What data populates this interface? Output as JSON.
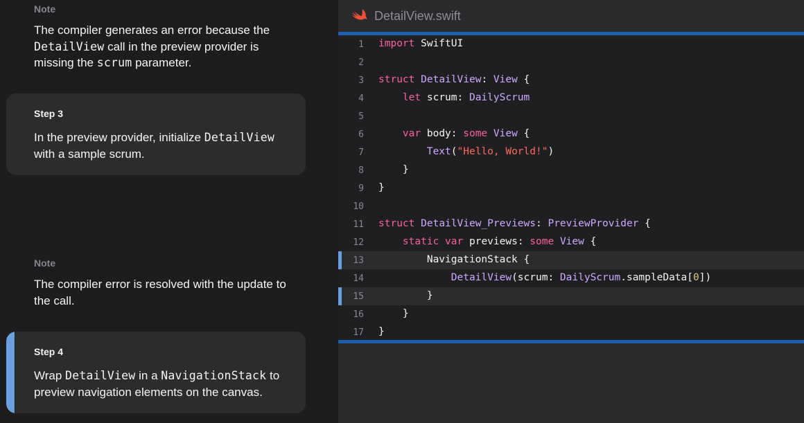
{
  "left": {
    "note1": {
      "label": "Note",
      "text_1": "The compiler generates an error because the ",
      "code_1": "DetailView",
      "text_2": " call in the preview provider is missing the ",
      "code_2": "scrum",
      "text_3": " parameter."
    },
    "step3": {
      "label": "Step 3",
      "text_1": "In the preview provider, initialize ",
      "code_1": "DetailView",
      "text_2": " with a sample scrum."
    },
    "note2": {
      "label": "Note",
      "text": "The compiler error is resolved with the update to the call."
    },
    "step4": {
      "label": "Step 4",
      "text_1": "Wrap ",
      "code_1": "DetailView",
      "text_2": " in a ",
      "code_2": "NavigationStack",
      "text_3": " to preview navigation elements on the canvas."
    }
  },
  "editor": {
    "file_name": "DetailView.swift",
    "icon": "swift-icon",
    "highlighted_lines": [
      13,
      15
    ],
    "lines": [
      {
        "n": "1",
        "tokens": [
          [
            "kw",
            "import"
          ],
          [
            "pl",
            " SwiftUI"
          ]
        ]
      },
      {
        "n": "2",
        "tokens": []
      },
      {
        "n": "3",
        "tokens": [
          [
            "kw",
            "struct"
          ],
          [
            "pl",
            " "
          ],
          [
            "ty",
            "DetailView"
          ],
          [
            "pl",
            ": "
          ],
          [
            "ty",
            "View"
          ],
          [
            "pl",
            " {"
          ]
        ]
      },
      {
        "n": "4",
        "tokens": [
          [
            "pl",
            "    "
          ],
          [
            "kw",
            "let"
          ],
          [
            "pl",
            " scrum: "
          ],
          [
            "ty",
            "DailyScrum"
          ]
        ]
      },
      {
        "n": "5",
        "tokens": []
      },
      {
        "n": "6",
        "tokens": [
          [
            "pl",
            "    "
          ],
          [
            "kw",
            "var"
          ],
          [
            "pl",
            " body: "
          ],
          [
            "kw",
            "some"
          ],
          [
            "pl",
            " "
          ],
          [
            "ty",
            "View"
          ],
          [
            "pl",
            " {"
          ]
        ]
      },
      {
        "n": "7",
        "tokens": [
          [
            "pl",
            "        "
          ],
          [
            "ty",
            "Text"
          ],
          [
            "pl",
            "("
          ],
          [
            "str",
            "\"Hello, World!\""
          ],
          [
            "pl",
            ")"
          ]
        ]
      },
      {
        "n": "8",
        "tokens": [
          [
            "pl",
            "    }"
          ]
        ]
      },
      {
        "n": "9",
        "tokens": [
          [
            "pl",
            "}"
          ]
        ]
      },
      {
        "n": "10",
        "tokens": []
      },
      {
        "n": "11",
        "tokens": [
          [
            "kw",
            "struct"
          ],
          [
            "pl",
            " "
          ],
          [
            "ty",
            "DetailView_Previews"
          ],
          [
            "pl",
            ": "
          ],
          [
            "ty",
            "PreviewProvider"
          ],
          [
            "pl",
            " {"
          ]
        ]
      },
      {
        "n": "12",
        "tokens": [
          [
            "pl",
            "    "
          ],
          [
            "kw",
            "static"
          ],
          [
            "pl",
            " "
          ],
          [
            "kw",
            "var"
          ],
          [
            "pl",
            " previews: "
          ],
          [
            "kw",
            "some"
          ],
          [
            "pl",
            " "
          ],
          [
            "ty",
            "View"
          ],
          [
            "pl",
            " {"
          ]
        ]
      },
      {
        "n": "13",
        "tokens": [
          [
            "pl",
            "        NavigationStack {"
          ]
        ]
      },
      {
        "n": "14",
        "tokens": [
          [
            "pl",
            "            "
          ],
          [
            "ty",
            "DetailView"
          ],
          [
            "pl",
            "(scrum: "
          ],
          [
            "ty",
            "DailyScrum"
          ],
          [
            "pl",
            ".sampleData["
          ],
          [
            "num",
            "0"
          ],
          [
            "pl",
            "])"
          ]
        ]
      },
      {
        "n": "15",
        "tokens": [
          [
            "pl",
            "        }"
          ]
        ]
      },
      {
        "n": "16",
        "tokens": [
          [
            "pl",
            "    }"
          ]
        ]
      },
      {
        "n": "17",
        "tokens": [
          [
            "pl",
            "}"
          ]
        ]
      }
    ]
  }
}
